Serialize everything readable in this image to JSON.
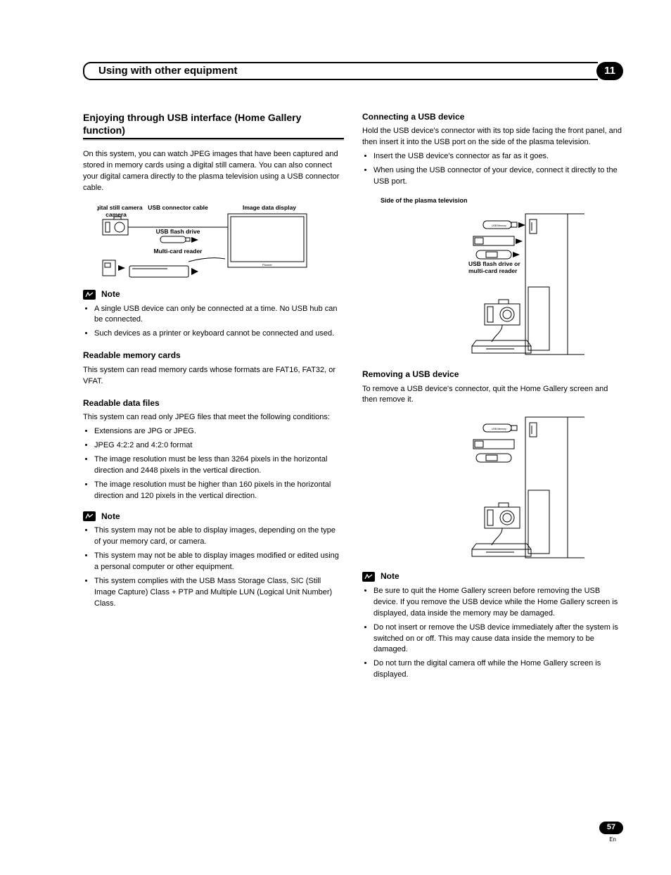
{
  "chapter": {
    "title": "Using with other equipment",
    "number": "11"
  },
  "left": {
    "heading": "Enjoying through USB interface (Home Gallery function)",
    "intro": "On this system, you can watch JPEG images that have been captured and stored in memory cards using a digital still camera. You can also connect your digital camera directly to the plasma television using a USB connector cable.",
    "diagram": {
      "camera": "Digital still camera",
      "cable": "USB connector cable",
      "display": "Image data display",
      "flash": "USB flash drive",
      "reader": "Multi-card reader"
    },
    "note1_label": "Note",
    "note1": [
      "A single USB device can only be connected at a time. No USB hub can be connected.",
      "Such devices as a printer or keyboard cannot be connected and used."
    ],
    "mem_heading": "Readable memory cards",
    "mem_text": "This system can read memory cards whose formats are FAT16, FAT32, or VFAT.",
    "data_heading": "Readable data files",
    "data_text": "This system can read only JPEG files that meet the following conditions:",
    "data_bullets": [
      "Extensions are JPG or JPEG.",
      "JPEG 4:2:2 and 4:2:0 format",
      "The image resolution must be less than 3264 pixels in the horizontal direction and 2448 pixels in the vertical direction.",
      "The image resolution must be higher than 160 pixels in the horizontal direction and 120 pixels in the vertical direction."
    ],
    "note2_label": "Note",
    "note2": [
      "This system may not be able to display images, depending on the type of your memory card, or camera.",
      "This system may not be able to display images modified or edited using a personal computer or other equipment.",
      "This system complies with the USB Mass Storage Class, SIC (Still Image Capture) Class + PTP and Multiple LUN (Logical Unit Number) Class."
    ]
  },
  "right": {
    "connect_heading": "Connecting a USB device",
    "connect_text": "Hold the USB device's connector with its top side facing the front panel, and then insert it into the USB port on the side of the plasma television.",
    "connect_bullets": [
      "Insert the USB device's connector as far as it goes.",
      "When using the USB connector of your device, connect it directly to the USB port."
    ],
    "side_caption": "Side of the plasma television",
    "diagram_label": "USB flash drive or multi-card reader",
    "remove_heading": "Removing a USB device",
    "remove_text": "To remove a USB device's connector, quit the Home Gallery screen and then remove it.",
    "note3_label": "Note",
    "note3": [
      "Be sure to quit the Home Gallery screen before removing the USB device. If you remove the USB device while the Home Gallery screen is displayed, data inside the memory may be damaged.",
      "Do not insert or remove the USB device immediately after the system is switched on or off. This may cause data inside the memory to be damaged.",
      "Do not turn the digital camera off while the Home Gallery screen is displayed."
    ]
  },
  "footer": {
    "page": "57",
    "lang": "En"
  }
}
